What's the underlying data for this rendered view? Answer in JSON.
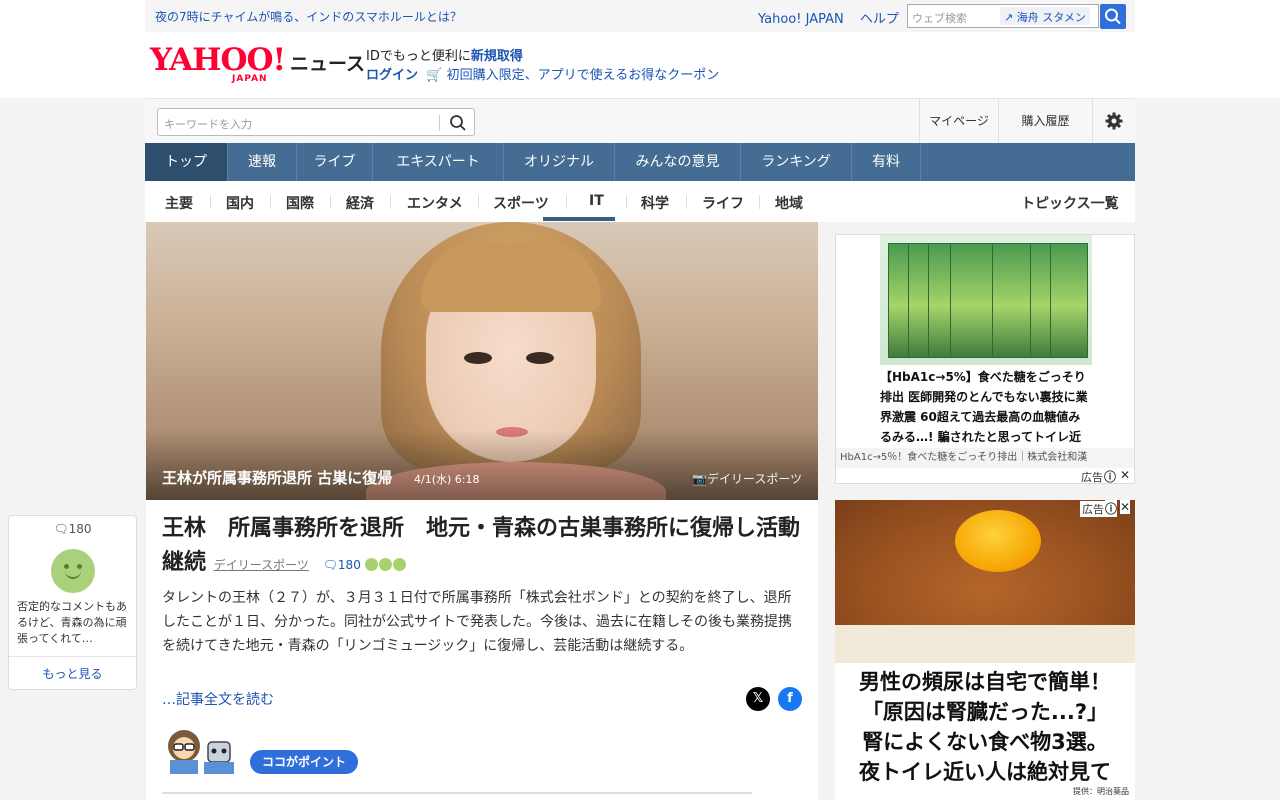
{
  "topbar": {
    "promo": "夜の7時にチャイムが鳴る、インドのスマホルールとは？",
    "yahoo_japan": "Yahoo! JAPAN",
    "help": "ヘルプ",
    "search_placeholder": "ウェブ検索",
    "trend": "海舟 スタメン"
  },
  "header": {
    "logo_yahoo": "YAHOO!",
    "logo_japan": "JAPAN",
    "logo_news": "ニュース",
    "id_text": "IDでもっと便利に",
    "register": "新規取得",
    "login": "ログイン",
    "coupon": "初回購入限定、アプリで使えるお得なクーポン"
  },
  "searchrow": {
    "placeholder": "キーワードを入力",
    "mypage": "マイページ",
    "history": "購入履歴"
  },
  "mainnav": [
    "トップ",
    "速報",
    "ライブ",
    "エキスパート",
    "オリジナル",
    "みんなの意見",
    "ランキング",
    "有料"
  ],
  "subnav": {
    "items": [
      "主要",
      "国内",
      "国際",
      "経済",
      "エンタメ",
      "スポーツ",
      "IT",
      "科学",
      "ライフ",
      "地域"
    ],
    "active": "エンタメ",
    "topics": "トピックス一覧"
  },
  "hero": {
    "caption": "王林が所属事務所退所 古巣に復帰",
    "date": "4/1(水) 6:18",
    "source": "デイリースポーツ"
  },
  "article": {
    "title": "王林　所属事務所を退所　地元・青森の古巣事務所に復帰し活動継続",
    "source": "デイリースポーツ",
    "comment_count": "180",
    "body": "タレントの王林（２７）が、３月３１日付で所属事務所「株式会社ボンド」との契約を終了し、退所したことが１日、分かった。同社が公式サイトで発表した。今後は、過去に在籍しその後も業務提携を続けてきた地元・青森の「リンゴミュージック」に復帰し、芸能活動は継続する。",
    "read_more": "…記事全文を読む",
    "point_badge": "ココがポイント"
  },
  "comment_widget": {
    "count": "180",
    "text": "否定的なコメントもあるけど、青森の為に頑張ってくれて…",
    "more": "もっと見る"
  },
  "ad1": {
    "headline": "【HbA1c→5%】食べた糖をごっそり排出 医師開発のとんでもない裏技に業界激震 60超えて過去最高の血糖値みるみる…! 騙されたと思ってトイレ近い人やって→",
    "footer": "HbA1c→5％！食べた糖をごっそり排出｜株式会社和漢",
    "label": "広告"
  },
  "ad2": {
    "lines": [
      "男性の頻尿は自宅で簡単！",
      "「原因は腎臓だった...?」",
      "腎によくない食べ物3選。",
      "夜トイレ近い人は絶対見て"
    ],
    "credit": "提供：明治薬品",
    "label": "広告"
  },
  "colors": {
    "brand_red": "#ff0033",
    "nav_blue": "#456c92",
    "nav_active": "#2e4e6e",
    "link_blue": "#1a54b4"
  }
}
